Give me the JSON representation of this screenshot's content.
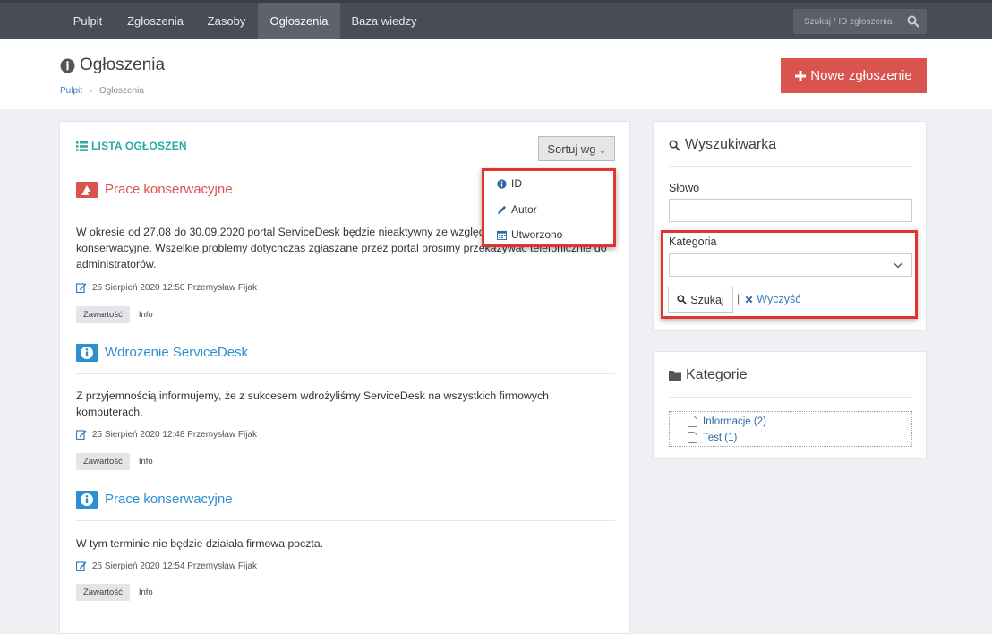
{
  "nav": {
    "items": [
      {
        "label": "Pulpit",
        "active": false
      },
      {
        "label": "Zgłoszenia",
        "active": false
      },
      {
        "label": "Zasoby",
        "active": false
      },
      {
        "label": "Ogłoszenia",
        "active": true
      },
      {
        "label": "Baza wiedzy",
        "active": false
      }
    ],
    "search_placeholder": "Szukaj / ID zgłoszenia"
  },
  "header": {
    "title": "Ogłoszenia",
    "breadcrumb": [
      "Pulpit",
      "Ogłoszenia"
    ],
    "new_button": "Nowe zgłoszenie"
  },
  "list": {
    "title": "LISTA OGŁOSZEŃ",
    "sort_label": "Sortuj wg",
    "sort_options": [
      "ID",
      "Autor",
      "Utworzono"
    ],
    "announcements": [
      {
        "title": "Prace konserwacyjne",
        "icon": "warning-icon",
        "color": "#d9534f",
        "body": "W okresie od 27.08 do 30.09.2020 portal ServiceDesk będzie nieaktywny ze względu na prace konserwacyjne. Wszelkie problemy dotychczas zgłaszane przez portal prosimy przekazywać telefonicznie do administratorów.",
        "meta": "25 Sierpień 2020 12:50 Przemysław Fijak",
        "tag_content": "Zawartość",
        "tag_category": "Info"
      },
      {
        "title": "Wdrożenie ServiceDesk",
        "icon": "info-icon",
        "color": "#2d8fd0",
        "body": "Z przyjemnością informujemy, że z sukcesem wdrożyliśmy ServiceDesk na wszystkich firmowych komputerach.",
        "meta": "25 Sierpień 2020 12:48 Przemysław Fijak",
        "tag_content": "Zawartość",
        "tag_category": "Info"
      },
      {
        "title": "Prace konserwacyjne",
        "icon": "info-icon",
        "color": "#2d8fd0",
        "body": "W tym terminie nie będzie działała firmowa poczta.",
        "meta": "25 Sierpień 2020 12:54 Przemysław Fijak",
        "tag_content": "Zawartość",
        "tag_category": "Info"
      }
    ]
  },
  "search_panel": {
    "title": "Wyszukiwarka",
    "word_label": "Słowo",
    "word_value": "",
    "category_label": "Kategoria",
    "category_value": "",
    "search_button": "Szukaj",
    "clear_link": "Wyczyść"
  },
  "categories_panel": {
    "title": "Kategorie",
    "items": [
      "Informacje (2)",
      "Test (1)"
    ]
  },
  "colors": {
    "accent_red": "#d9534f",
    "link_blue": "#3a7bb8",
    "teal": "#2aa7a7",
    "highlight": "#e0342c"
  }
}
